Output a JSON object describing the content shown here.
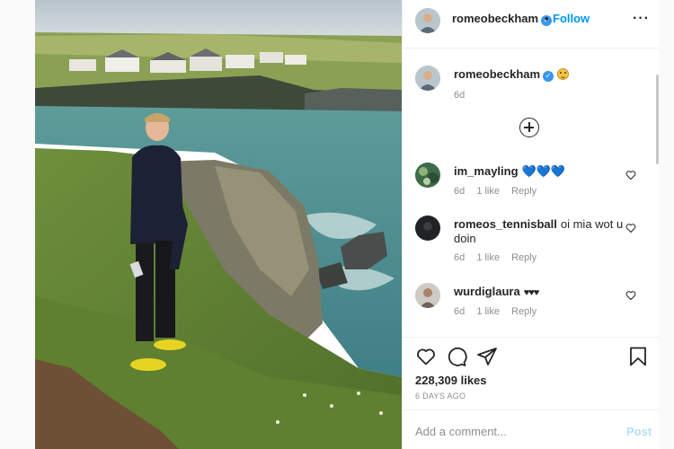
{
  "post": {
    "username": "romeobeckham",
    "follow_label": "Follow",
    "separator": "•",
    "more_label": "•••"
  },
  "caption": {
    "username": "romeobeckham",
    "time": "6d"
  },
  "comments": [
    {
      "username": "im_mayling",
      "text": "💙💙💙",
      "time": "6d",
      "likes": "1 like",
      "reply": "Reply"
    },
    {
      "username": "romeos_tennisball",
      "text": "oi mia wot u doin",
      "time": "6d",
      "likes": "1 like",
      "reply": "Reply"
    },
    {
      "username": "wurdiglaura",
      "text": "♥♥♥",
      "time": "6d",
      "likes": "1 like",
      "reply": "Reply"
    }
  ],
  "actions": {
    "likes": "228,309 likes",
    "date": "6 DAYS AGO"
  },
  "add_comment": {
    "placeholder": "Add a comment...",
    "post_label": "Post"
  },
  "colors": {
    "accent": "#0095f6",
    "verified": "#3897f0",
    "post_disabled": "#b2dffc",
    "muted": "#8e8e8e"
  },
  "icons": [
    "verified-badge-icon",
    "more-icon",
    "smiley-emoji-icon",
    "plus-circle-icon",
    "heart-icon",
    "comment-icon",
    "share-icon",
    "bookmark-icon"
  ]
}
